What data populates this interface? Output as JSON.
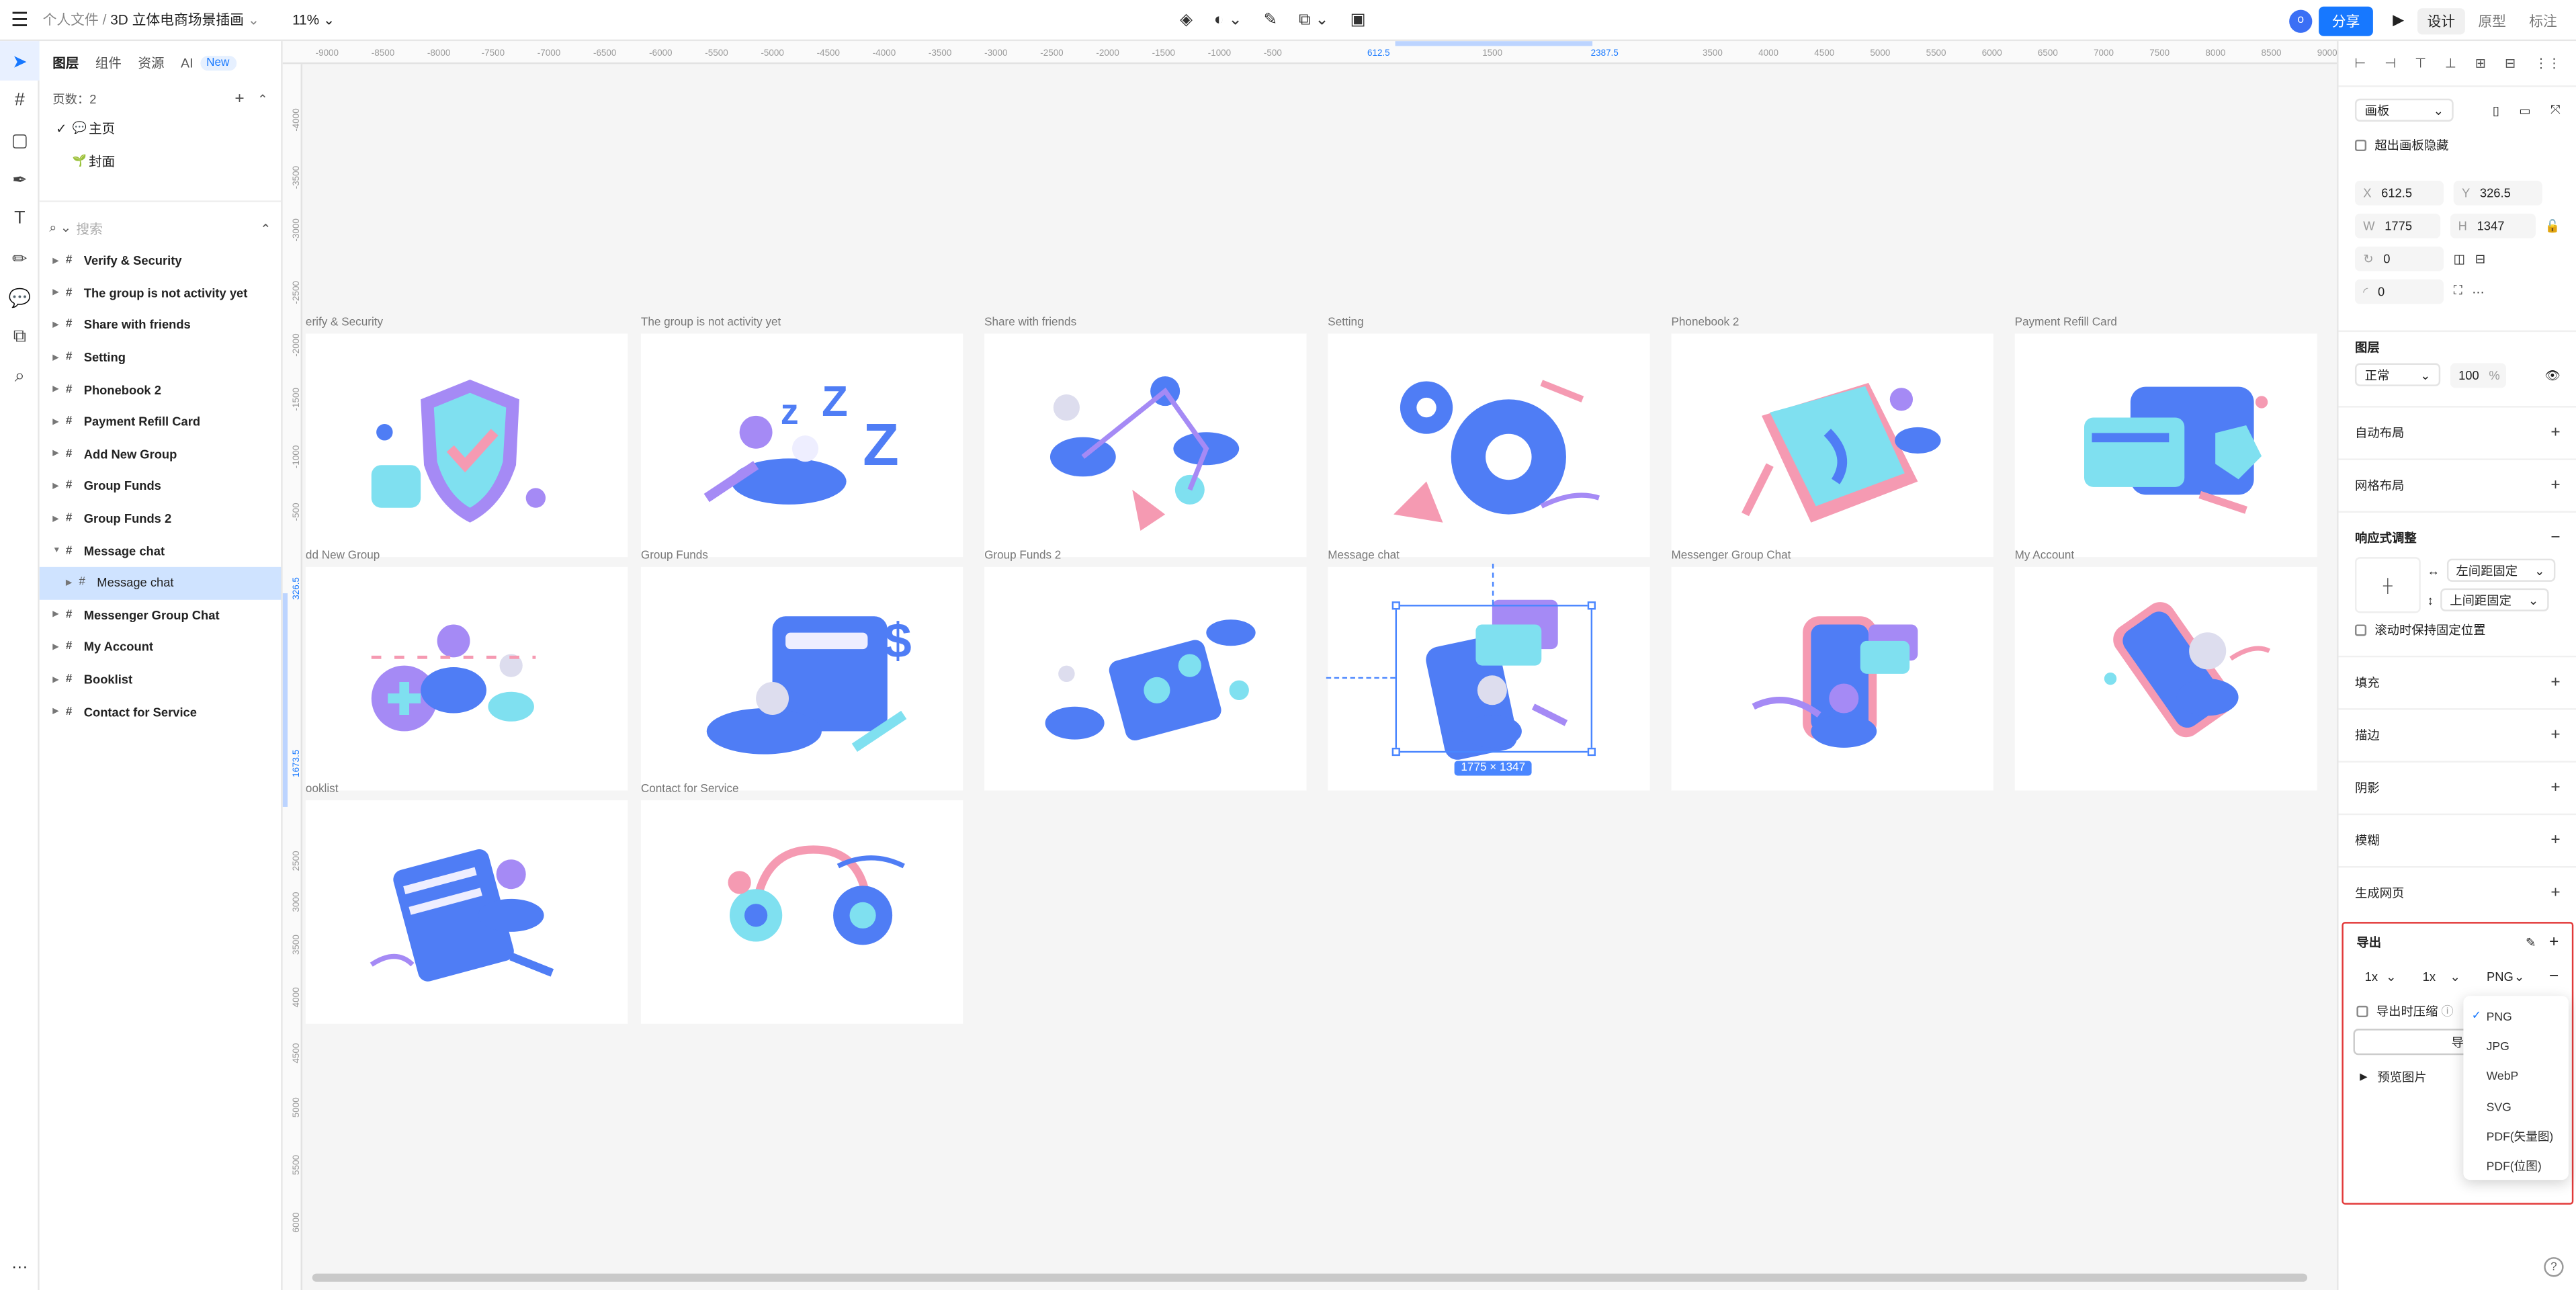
{
  "header": {
    "breadcrumb_parent": "个人文件",
    "separator": "/",
    "file_name": "3D 立体电商场景插画",
    "zoom": "11%",
    "avatar_initial": "o",
    "share_label": "分享",
    "modes": [
      "设计",
      "原型",
      "标注"
    ]
  },
  "left_panel": {
    "tabs": [
      "图层",
      "组件",
      "资源",
      "AI"
    ],
    "ai_badge": "New",
    "pages_count_label": "页数：2",
    "pages": [
      {
        "name": "主页",
        "emoji": "💬",
        "current": true
      },
      {
        "name": "封面",
        "emoji": "🌱",
        "current": false
      }
    ],
    "search_placeholder": "搜索",
    "layers": [
      "Verify & Security",
      "The group is not activity yet",
      "Share with friends",
      "Setting",
      "Phonebook 2",
      "Payment Refill Card",
      "Add New Group",
      "Group Funds",
      "Group Funds 2",
      "Message chat",
      "Message chat",
      "Messenger Group Chat",
      "My Account",
      "Booklist",
      "Contact for Service"
    ]
  },
  "canvas": {
    "ruler_top": [
      "-9000",
      "-8500",
      "-8000",
      "-7500",
      "-7000",
      "-6500",
      "-6000",
      "-5500",
      "-5000",
      "-4500",
      "-4000",
      "-3500",
      "-3000",
      "-2500",
      "-2000",
      "-1500",
      "-1000",
      "-500",
      "612.5",
      "1500",
      "2387.5",
      "3500",
      "4000",
      "4500",
      "5000",
      "5500",
      "6000",
      "6500",
      "7000",
      "7500",
      "8000",
      "8500",
      "9000"
    ],
    "ruler_left": [
      "-4000",
      "-3500",
      "-3000",
      "-2500",
      "-2000",
      "-1500",
      "-1000",
      "-500",
      "326.5",
      "1673.5",
      "2500",
      "3000",
      "3500",
      "4000",
      "4500",
      "5000",
      "5500",
      "6000"
    ],
    "frame_labels": [
      "erify & Security",
      "The group is not activity yet",
      "Share with friends",
      "Setting",
      "Phonebook 2",
      "Payment Refill Card",
      "dd New Group",
      "Group Funds",
      "Group Funds 2",
      "Message chat",
      "Messenger Group Chat",
      "My Account",
      "ooklist",
      "Contact for Service"
    ],
    "selection_size": "1775 × 1347"
  },
  "right_panel": {
    "frame_type": "画板",
    "clip_content": "超出画板隐藏",
    "x_label": "X",
    "x": "612.5",
    "y_label": "Y",
    "y": "326.5",
    "w_label": "W",
    "w": "1775",
    "h_label": "H",
    "h": "1347",
    "rotation": "0",
    "radius": "0",
    "layer_title": "图层",
    "blend_mode": "正常",
    "opacity": "100",
    "opacity_unit": "%",
    "auto_layout": "自动布局",
    "grid_layout": "网格布局",
    "responsive": "响应式调整",
    "h_constraint": "左间距固定",
    "v_constraint": "上间距固定",
    "fixed_scroll": "滚动时保持固定位置",
    "fill": "填充",
    "stroke": "描边",
    "shadow": "阴影",
    "blur": "模糊",
    "gen_web": "生成网页",
    "export_title": "导出",
    "export_scale": "1x",
    "export_suffix": "1x",
    "export_format": "PNG",
    "compress_label": "导出时压缩",
    "export_button_partial": "导",
    "preview_label": "预览图片",
    "format_options": [
      "PNG",
      "JPG",
      "WebP",
      "SVG",
      "PDF(矢量图)",
      "PDF(位图)"
    ]
  },
  "colors": {
    "accent": "#1778ff",
    "selection": "#4a86ff",
    "highlight_box": "#e23a3a",
    "illustration_blue": "#4f7df5",
    "illustration_cyan": "#7fe0f0",
    "illustration_purple": "#a58af5",
    "illustration_pink": "#f59ab2"
  },
  "icons": {
    "menu": "hamburger-icon",
    "play": "play-icon",
    "dropdown": "chevron-down-icon"
  }
}
